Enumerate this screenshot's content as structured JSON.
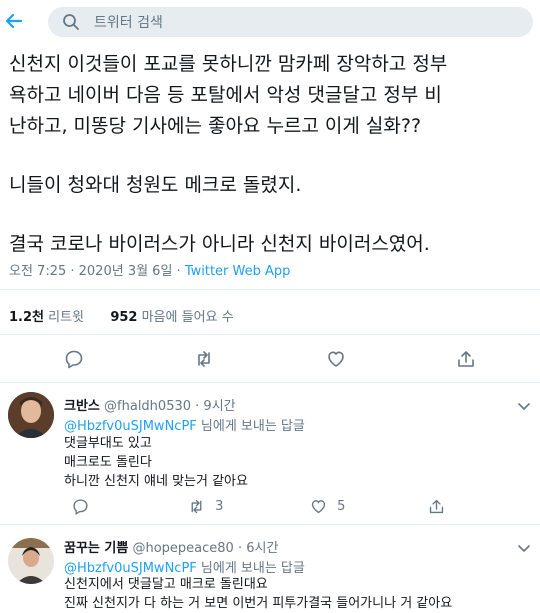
{
  "search": {
    "placeholder": "트위터 검색"
  },
  "tweet": {
    "lines_p1": [
      "신천지 이것들이 포교를 못하니깐 맘카페 장악하고 정부",
      "욕하고 네이버 다음 등 포탈에서 악성 댓글달고 정부 비",
      "난하고, 미똥당 기사에는 좋아요 누르고 이게 실화??"
    ],
    "p2": "니들이 청와대 청원도 메크로 돌렸지.",
    "p3": "결국 코로나 바이러스가 아니라 신천지 바이러스였어.",
    "timestamp": "오전 7:25 · 2020년 3월 6일 · ",
    "source": "Twitter Web App",
    "retweets_count": "1.2천",
    "retweets_label": "리트윗",
    "likes_count": "952",
    "likes_label": "마음에 들어요 수"
  },
  "replies": [
    {
      "name": "크반스",
      "handle": "@fhaldh0530",
      "time": "· 9시간",
      "to_handle": "@Hbzfv0uSJMwNcPF",
      "to_suffix": " 님에게 보내는 답글",
      "lines": [
        "댓글부대도 있고",
        "매크로도 돌린다",
        "하니깐 신천지 얘네 맞는거 같아요"
      ],
      "retweets": "3",
      "likes": "5"
    },
    {
      "name": "꿈꾸는 기쁨",
      "handle": "@hopepeace80",
      "time": "· 6시간",
      "to_handle": "@Hbzfv0uSJMwNcPF",
      "to_suffix": " 님에게 보내는 답글",
      "lines": [
        "신천지에서 댓글달고 매크로 돌린대요",
        "진짜 신천지가 다 하는 거 보면 이번거 피투가결국 들어가니나 거 같아요"
      ]
    }
  ]
}
